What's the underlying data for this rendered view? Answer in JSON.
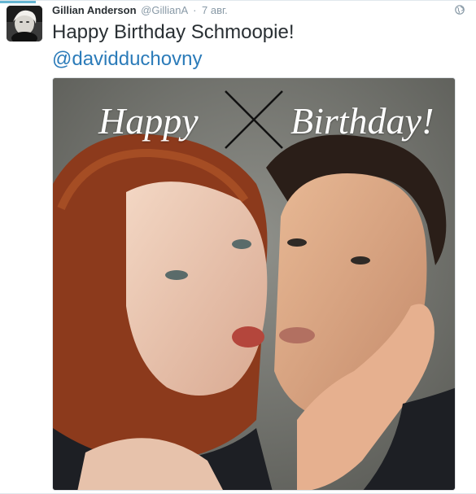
{
  "tweet": {
    "fullname": "Gillian Anderson",
    "username": "@GillianA",
    "separator": "·",
    "time": "7 авг.",
    "text": "Happy Birthday Schmoopie!",
    "mention": "@davidduchovny",
    "avatar_icon": "user-avatar",
    "visibility_icon": "globe-icon"
  },
  "media": {
    "overlay_left": "Happy",
    "overlay_right": "Birthday!",
    "mark_icon": "x-mark-icon"
  },
  "colors": {
    "name_text": "#292f33",
    "meta_text": "#8899a6",
    "link": "#2b7bb9",
    "accent": "#66b5d2"
  }
}
